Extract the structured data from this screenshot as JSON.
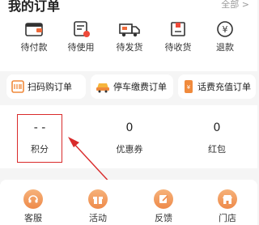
{
  "header": {
    "title": "我的订单",
    "all_link": "全部 >"
  },
  "orders": [
    {
      "label": "待付款",
      "icon": "wallet-icon"
    },
    {
      "label": "待使用",
      "icon": "ticket-icon"
    },
    {
      "label": "待发货",
      "icon": "truck-icon"
    },
    {
      "label": "待收货",
      "icon": "package-icon"
    },
    {
      "label": "退款",
      "icon": "yuan-refund-icon"
    }
  ],
  "quick": [
    {
      "label": "扫码购订单",
      "icon": "scan-icon"
    },
    {
      "label": "停车缴费订单",
      "icon": "car-icon"
    },
    {
      "label": "话费充值订单",
      "icon": "phone-icon"
    }
  ],
  "assets": [
    {
      "value": "- -",
      "label": "积分"
    },
    {
      "value": "0",
      "label": "优惠券"
    },
    {
      "value": "0",
      "label": "红包"
    }
  ],
  "services": [
    {
      "label": "客服",
      "icon": "headset-icon"
    },
    {
      "label": "活动",
      "icon": "gift-icon"
    },
    {
      "label": "反馈",
      "icon": "edit-icon"
    },
    {
      "label": "门店",
      "icon": "store-icon"
    }
  ],
  "colors": {
    "accent": "#f08a3c",
    "annotation": "#d92b2b"
  }
}
